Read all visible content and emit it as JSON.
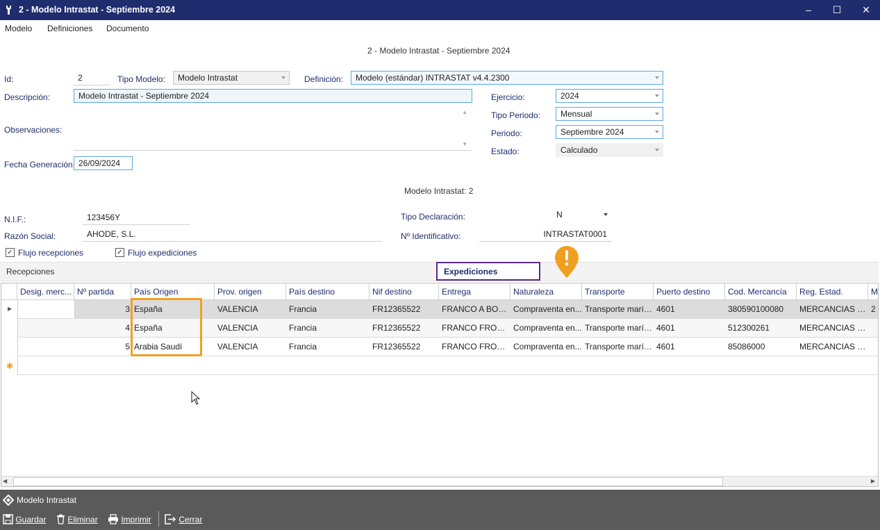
{
  "window": {
    "title": "2 - Modelo Intrastat - Septiembre 2024"
  },
  "menu": [
    "Modelo",
    "Definiciones",
    "Documento"
  ],
  "form": {
    "header": "2 - Modelo Intrastat - Septiembre 2024",
    "id_label": "Id:",
    "id_value": "2",
    "tipo_modelo_label": "Tipo Modelo:",
    "tipo_modelo_value": "Modelo Intrastat",
    "definicion_label": "Definición:",
    "definicion_value": "Modelo (estándar) INTRASTAT v4.4.2300",
    "descripcion_label": "Descripción:",
    "descripcion_value": "Modelo Intrastat - Septiembre 2024",
    "observaciones_label": "Observaciones:",
    "ejercicio_label": "Ejercicio:",
    "ejercicio_value": "2024",
    "tipo_periodo_label": "Tipo Periodo:",
    "tipo_periodo_value": "Mensual",
    "periodo_label": "Periodo:",
    "periodo_value": "Septiembre 2024",
    "estado_label": "Estado:",
    "estado_value": "Calculado",
    "fecha_label": "Fecha Generación:",
    "fecha_value": "26/09/2024"
  },
  "sub": {
    "header": "Modelo Intrastat: 2",
    "nif_label": "N.I.F.:",
    "nif_value": "123456Y",
    "razon_label": "Razón Social:",
    "razon_value": "AHODE, S.L.",
    "tipo_decl_label": "Tipo Declaración:",
    "tipo_decl_value": "N",
    "num_ident_label": "Nº Identificativo:",
    "num_ident_value": "INTRASTAT0001",
    "flujo_recepciones": "Flujo recepciones",
    "flujo_expediciones": "Flujo expediciones"
  },
  "tabs": {
    "recepciones": "Recepciones",
    "expediciones": "Expediciones"
  },
  "callout_icon": "alert-marker-icon",
  "grid": {
    "columns": [
      "Desig. merc...",
      "Nº partida",
      "País Origen",
      "Prov. origen",
      "País destino",
      "Nif destino",
      "Entrega",
      "Naturaleza",
      "Transporte",
      "Puerto destino",
      "Cod. Mercancía",
      "Reg. Estad.",
      "M"
    ],
    "rows": [
      [
        "",
        "3",
        "España",
        "VALENCIA",
        "Francia",
        "FR12365522",
        "FRANCO A BORDO",
        "Compraventa en...",
        "Transporte maríti...",
        "4601",
        "380590100080",
        "MERCANCIAS D...",
        "2"
      ],
      [
        "",
        "4",
        "España",
        "VALENCIA",
        "Francia",
        "FR12365522",
        "FRANCO FRONT...",
        "Compraventa en...",
        "Transporte maríti...",
        "4601",
        "512300261",
        "MERCANCIAS D...",
        ""
      ],
      [
        "",
        "5",
        "Arabia Saudí",
        "VALENCIA",
        "Francia",
        "FR12365522",
        "FRANCO FRONT...",
        "Compraventa en...",
        "Transporte maríti...",
        "4601",
        "85086000",
        "MERCANCIAS D...",
        ""
      ]
    ]
  },
  "footer": {
    "title": "Modelo Intrastat",
    "guardar": "Guardar",
    "eliminar": "Eliminar",
    "imprimir": "Imprimir",
    "cerrar": "Cerrar"
  },
  "colors": {
    "titlebar": "#1f2c6e",
    "highlight_orange": "#f0a020",
    "highlight_purple": "#5b2a86",
    "footer": "#5a5a5a"
  }
}
